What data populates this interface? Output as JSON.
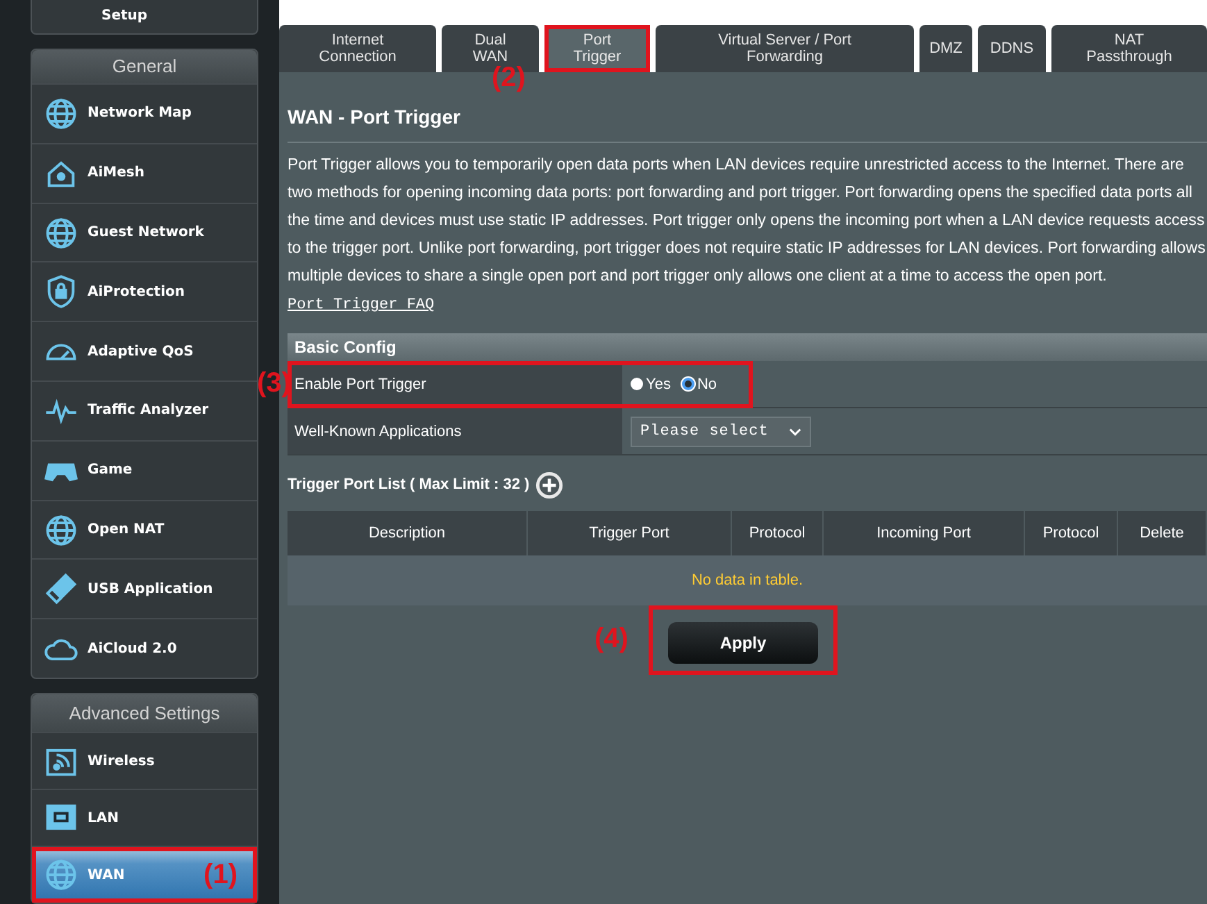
{
  "sidebar": {
    "top_item": {
      "label": "Setup"
    },
    "sections": [
      {
        "title": "General",
        "items": [
          {
            "label": "Network Map",
            "selected": false
          },
          {
            "label": "AiMesh",
            "selected": false
          },
          {
            "label": "Guest Network",
            "selected": false
          },
          {
            "label": "AiProtection",
            "selected": false
          },
          {
            "label": "Adaptive QoS",
            "selected": false
          },
          {
            "label": "Traffic Analyzer",
            "selected": false
          },
          {
            "label": "Game",
            "selected": false
          },
          {
            "label": "Open NAT",
            "selected": false
          },
          {
            "label": "USB Application",
            "selected": false
          },
          {
            "label": "AiCloud 2.0",
            "selected": false
          }
        ]
      },
      {
        "title": "Advanced Settings",
        "items": [
          {
            "label": "Wireless",
            "selected": false
          },
          {
            "label": "LAN",
            "selected": false
          },
          {
            "label": "WAN",
            "selected": true,
            "annotation": "(1)"
          }
        ]
      }
    ]
  },
  "tabs": [
    {
      "label": "Internet Connection",
      "selected": false
    },
    {
      "label": "Dual WAN",
      "selected": false
    },
    {
      "label": "Port Trigger",
      "selected": true,
      "annotation": "(2)"
    },
    {
      "label": "Virtual Server / Port Forwarding",
      "selected": false
    },
    {
      "label": "DMZ",
      "selected": false
    },
    {
      "label": "DDNS",
      "selected": false
    },
    {
      "label": "NAT Passthrough",
      "selected": false
    }
  ],
  "page": {
    "title": "WAN - Port Trigger",
    "description": "Port Trigger allows you to temporarily open data ports when LAN devices require unrestricted access to the Internet. There are two methods for opening incoming data ports: port forwarding and port trigger. Port forwarding opens the specified data ports all the time and devices must use static IP addresses. Port trigger only opens the incoming port when a LAN device requests access to the trigger port. Unlike port forwarding, port trigger does not require static IP addresses for LAN devices. Port forwarding allows multiple devices to share a single open port and port trigger only allows one client at a time to access the open port.",
    "faq_link": "Port Trigger FAQ"
  },
  "basic_config": {
    "title": "Basic Config",
    "rows": [
      {
        "kind": "radio",
        "label": "Enable Port Trigger",
        "annotation": "(3)",
        "options": [
          {
            "label": "Yes",
            "selected": false
          },
          {
            "label": "No",
            "selected": true
          }
        ]
      },
      {
        "kind": "select",
        "label": "Well-Known Applications",
        "value": "Please select"
      }
    ]
  },
  "trigger_list": {
    "title": "Trigger Port List ( Max Limit : 32 )",
    "columns": [
      "Description",
      "Trigger Port",
      "Protocol",
      "Incoming Port",
      "Protocol",
      "Delete"
    ],
    "empty_text": "No data in table."
  },
  "apply_button": {
    "label": "Apply",
    "annotation": "(4)"
  }
}
